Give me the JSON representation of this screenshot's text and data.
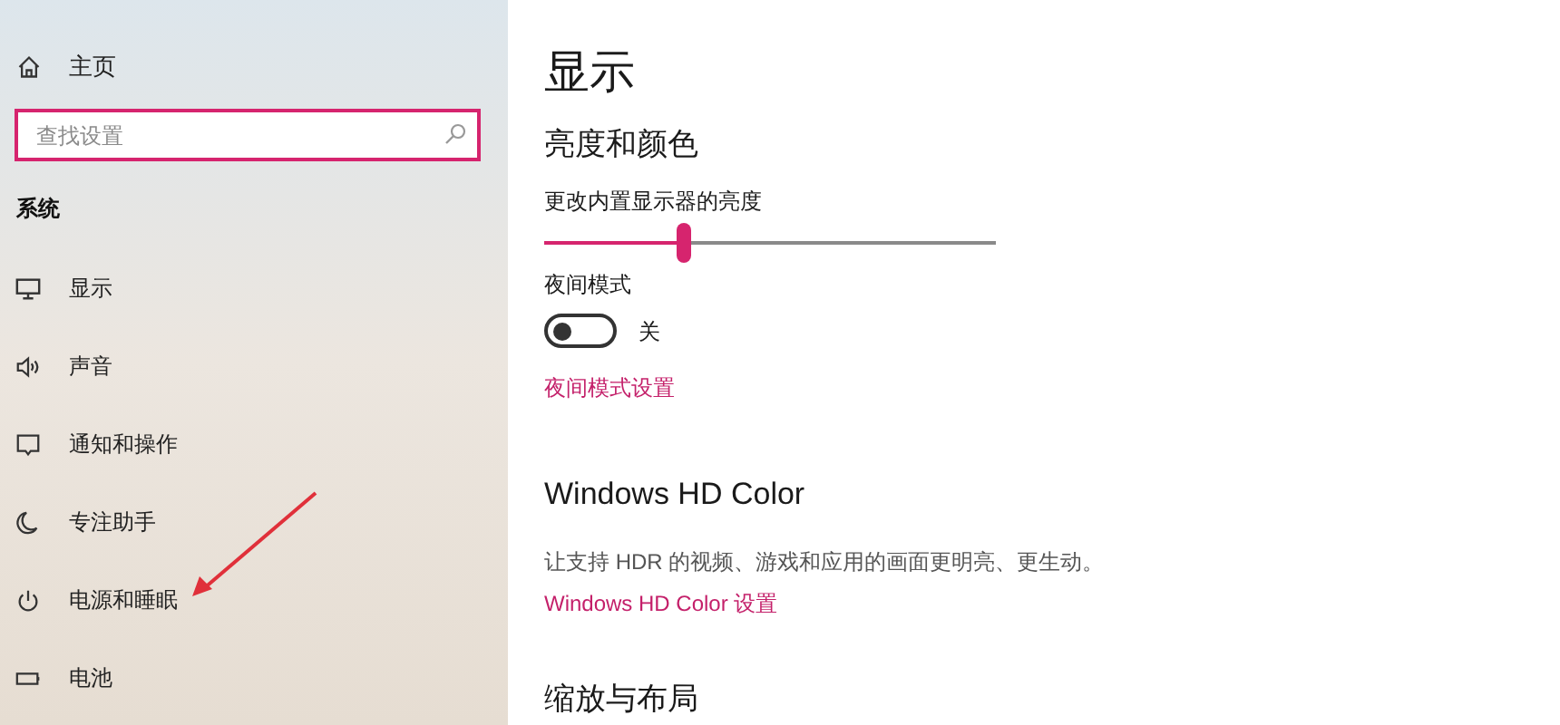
{
  "sidebar": {
    "home": "主页",
    "search": {
      "placeholder": "查找设置"
    },
    "section": "系统",
    "items": [
      {
        "kind": "display",
        "label": "显示"
      },
      {
        "kind": "sound",
        "label": "声音"
      },
      {
        "kind": "notify",
        "label": "通知和操作"
      },
      {
        "kind": "focus",
        "label": "专注助手"
      },
      {
        "kind": "power",
        "label": "电源和睡眠"
      },
      {
        "kind": "battery",
        "label": "电池"
      }
    ]
  },
  "content": {
    "title": "显示",
    "sections": [
      {
        "heading": "亮度和颜色",
        "brightness_label": "更改内置显示器的亮度",
        "brightness": {
          "level": 0.31
        },
        "night_label": "夜间模式",
        "night_mode": {
          "on": false,
          "state_text": "关"
        },
        "link": "夜间模式设置"
      },
      {
        "heading": "Windows HD Color",
        "description": "让支持 HDR 的视频、游戏和应用的画面更明亮、更生动。",
        "link": "Windows HD Color 设置"
      },
      {
        "heading": "缩放与布局"
      }
    ]
  }
}
